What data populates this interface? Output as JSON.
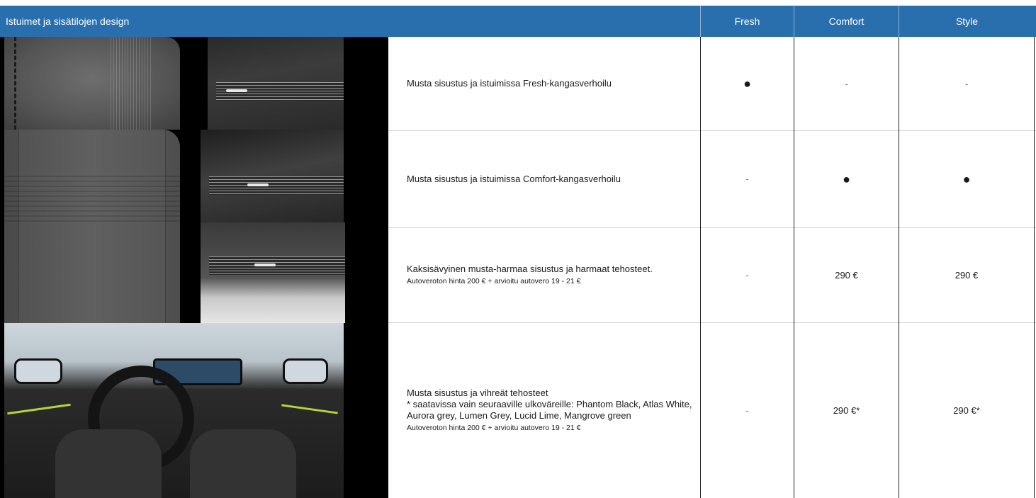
{
  "header": {
    "title": "Istuimet ja sisätilojen design",
    "columns": [
      "Fresh",
      "Comfort",
      "Style"
    ]
  },
  "colors": {
    "header_bg": "#2a6fad",
    "header_text": "#ffffff",
    "lime_accent": "#b6d43a"
  },
  "rows": [
    {
      "description": "Musta sisustus ja istuimissa Fresh-kangasverhoilu",
      "note": "",
      "fresh": "●",
      "comfort": "-",
      "style": "-"
    },
    {
      "description": "Musta sisustus ja istuimissa Comfort-kangasverhoilu",
      "note": "",
      "fresh": "-",
      "comfort": "●",
      "style": "●"
    },
    {
      "description": "Kaksisävyinen musta-harmaa sisustus ja harmaat tehosteet.",
      "note": "Autoveroton hinta 200 € + arvioitu autovero 19 - 21 €",
      "fresh": "-",
      "comfort": "290 €",
      "style": "290 €"
    },
    {
      "description": "Musta sisustus ja vihreät tehosteet",
      "description_2": "* saatavissa vain seuraaville ulkoväreille: Phantom Black, Atlas White, Aurora grey, Lumen Grey, Lucid Lime, Mangrove green",
      "note": "Autoveroton hinta 200 € + arvioitu autovero 19 - 21 €",
      "fresh": "-",
      "comfort": "290 €*",
      "style": "290 €*"
    }
  ],
  "images": [
    {
      "name": "fresh-fabric-seat-image"
    },
    {
      "name": "dashboard-trim-image-1"
    },
    {
      "name": "comfort-fabric-seat-image"
    },
    {
      "name": "dashboard-trim-image-2"
    },
    {
      "name": "dashboard-trim-grey-image"
    },
    {
      "name": "interior-green-accents-image"
    }
  ]
}
